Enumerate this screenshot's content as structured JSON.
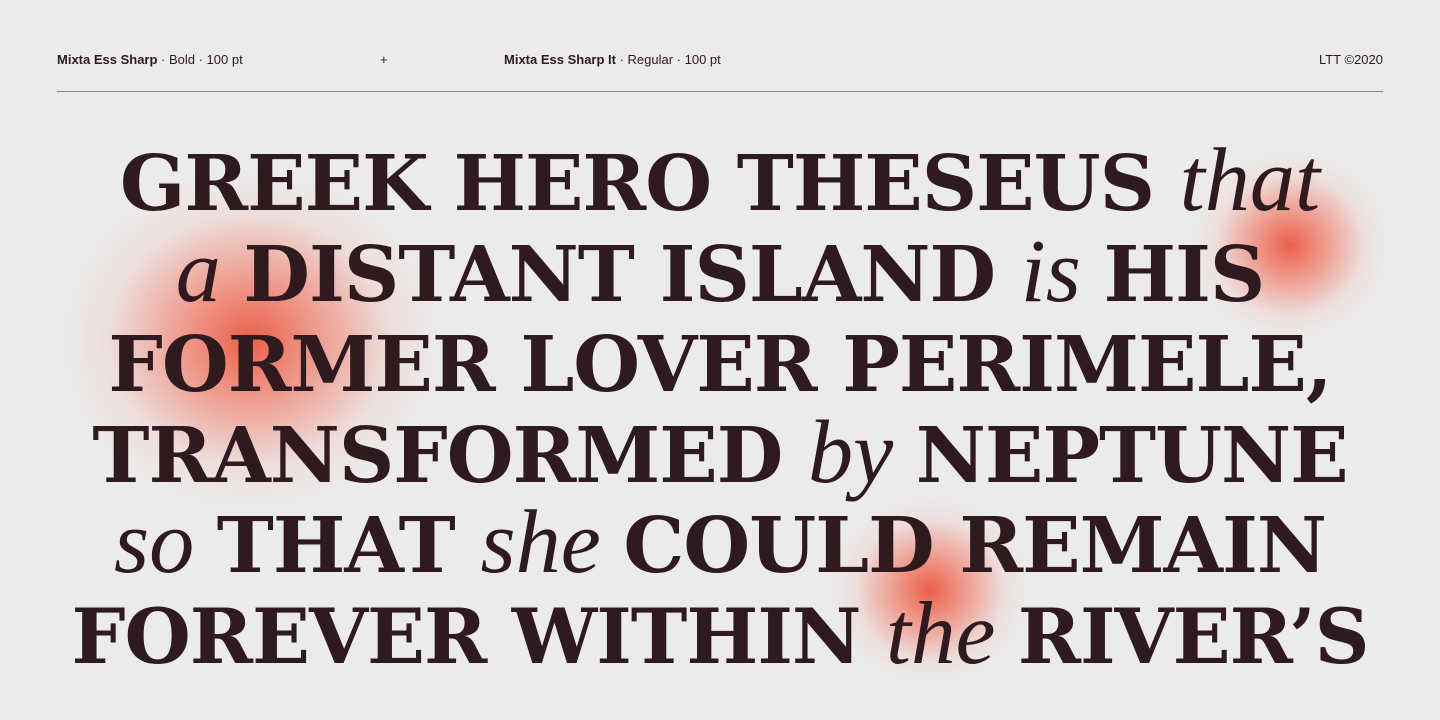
{
  "header": {
    "font1_name": "Mixta Ess Sharp",
    "font1_specs": " · Bold · 100 pt",
    "plus": "+",
    "font2_name": "Mixta Ess Sharp It",
    "font2_specs": " · Regular · 100 pt",
    "copyright": "LTT ©2020"
  },
  "colors": {
    "background": "#ebebeb",
    "text": "#2e1a1f",
    "accent": "#ec5840",
    "rule": "#8f8585"
  },
  "specimen": {
    "lines": [
      [
        {
          "t": "GREEK HERO THESEUS ",
          "s": "bold"
        },
        {
          "t": "that",
          "s": "ital"
        }
      ],
      [
        {
          "t": "a ",
          "s": "ital"
        },
        {
          "t": "DISTANT ISLAND ",
          "s": "bold"
        },
        {
          "t": "is ",
          "s": "ital"
        },
        {
          "t": "HIS",
          "s": "bold"
        }
      ],
      [
        {
          "t": "FORMER LOVER PERIMELE,",
          "s": "bold"
        }
      ],
      [
        {
          "t": "TRANSFORMED ",
          "s": "bold"
        },
        {
          "t": "by ",
          "s": "ital"
        },
        {
          "t": "NEPTUNE",
          "s": "bold"
        }
      ],
      [
        {
          "t": "so ",
          "s": "ital"
        },
        {
          "t": "THAT ",
          "s": "bold"
        },
        {
          "t": "she ",
          "s": "ital"
        },
        {
          "t": "COULD REMAIN",
          "s": "bold"
        }
      ],
      [
        {
          "t": "FOREVER WITHIN ",
          "s": "bold"
        },
        {
          "t": "the ",
          "s": "ital"
        },
        {
          "t": "RIVER’S",
          "s": "bold"
        }
      ]
    ]
  }
}
